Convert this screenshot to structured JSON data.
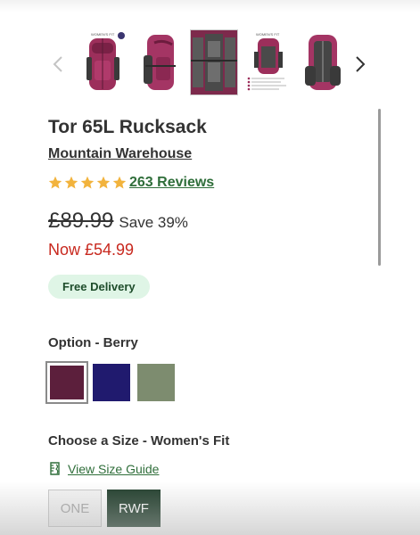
{
  "carousel": {
    "prev_icon": "chevron-left-icon",
    "next_icon": "chevron-right-icon",
    "thumbnails": [
      {
        "label": "WOMEN'S FIT"
      },
      {
        "label": ""
      },
      {
        "label": ""
      },
      {
        "label": "WOMEN'S FIT"
      },
      {
        "label": ""
      }
    ]
  },
  "product": {
    "title": "Tor 65L Rucksack",
    "brand": "Mountain Warehouse",
    "rating": 5,
    "reviews_label": "263 Reviews",
    "old_price": "£89.99",
    "save_label": "Save 39%",
    "now_price": "Now £54.99",
    "delivery_badge": "Free Delivery"
  },
  "options": {
    "label": "Option - Berry",
    "swatches": [
      {
        "name": "Berry",
        "color": "#5c1f3c",
        "selected": true
      },
      {
        "name": "Navy",
        "color": "#201a6e",
        "selected": false
      },
      {
        "name": "Khaki",
        "color": "#7d8c6f",
        "selected": false
      }
    ]
  },
  "sizes": {
    "label": "Choose a Size - Women's Fit",
    "guide_label": "View Size Guide",
    "guide_icon": "size-guide-icon",
    "items": [
      {
        "label": "ONE",
        "available": false
      },
      {
        "label": "RWF",
        "selected": true
      }
    ]
  },
  "colors": {
    "accent_green": "#2f6e3a",
    "price_red": "#c8281e",
    "star": "#f2b33d",
    "badge_bg": "#dff5e6",
    "selected_size_bg": "#213e2c"
  }
}
